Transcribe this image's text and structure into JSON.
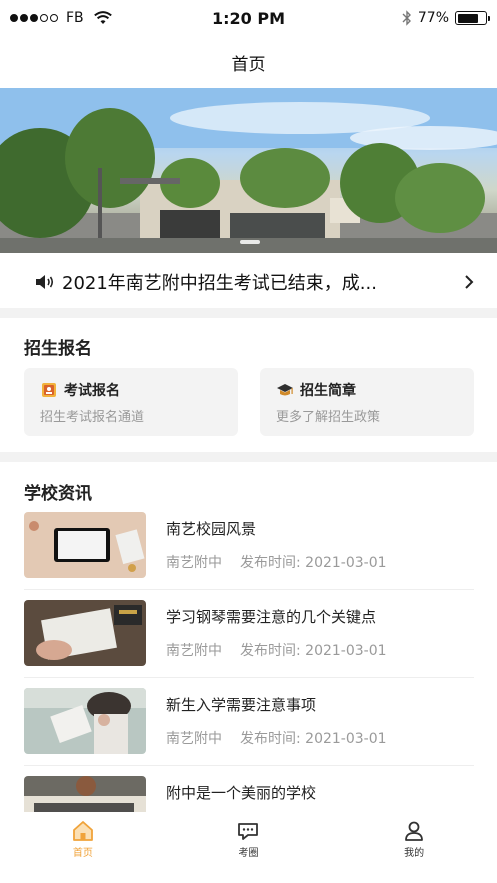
{
  "status_bar": {
    "carrier": "FB",
    "time": "1:20 PM",
    "battery_percent": "77%",
    "battery_level": 0.77,
    "signal_bars_filled": 3,
    "signal_bars_total": 5
  },
  "nav": {
    "title": "首页"
  },
  "banner": {
    "image_icon": "campus-building-photo",
    "page_indicator_count": 1
  },
  "notice": {
    "icon": "speaker-icon",
    "text": "2021年南艺附中招生考试已结束，成...",
    "arrow_icon": "chevron-right-icon"
  },
  "enrollment": {
    "title": "招生报名",
    "cards": [
      {
        "icon": "exam-registration-icon",
        "title": "考试报名",
        "subtitle": "招生考试报名通道"
      },
      {
        "icon": "graduation-cap-icon",
        "title": "招生简章",
        "subtitle": "更多了解招生政策"
      }
    ]
  },
  "news": {
    "title": "学校资讯",
    "items": [
      {
        "title": "南艺校园风景",
        "source": "南艺附中",
        "date": "发布时间: 2021-03-01",
        "thumb": "tablet-on-desk-photo"
      },
      {
        "title": "学习钢琴需要注意的几个关键点",
        "source": "南艺附中",
        "date": "发布时间: 2021-03-01",
        "thumb": "reading-book-photo"
      },
      {
        "title": "新生入学需要注意事项",
        "source": "南艺附中",
        "date": "发布时间: 2021-03-01",
        "thumb": "student-reading-photo"
      },
      {
        "title": "附中是一个美丽的学校",
        "source": "",
        "date": "",
        "thumb": "school-sign-photo"
      }
    ]
  },
  "tab_bar": {
    "items": [
      {
        "label": "首页",
        "icon": "home-icon",
        "active": true
      },
      {
        "label": "考圈",
        "icon": "chat-bubble-icon",
        "active": false
      },
      {
        "label": "我的",
        "icon": "user-icon",
        "active": false
      }
    ],
    "active_color": "#f0a33a"
  }
}
